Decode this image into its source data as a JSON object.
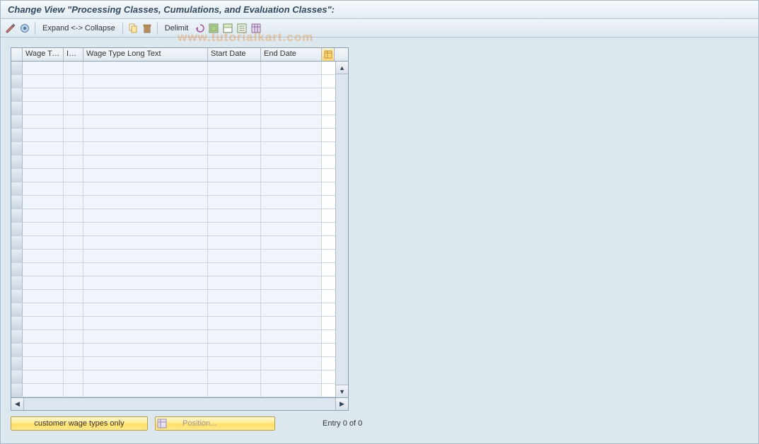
{
  "title": "Change View \"Processing Classes, Cumulations, and Evaluation Classes\":",
  "toolbar": {
    "expand_label": "Expand <-> Collapse",
    "delimit_label": "Delimit"
  },
  "table": {
    "columns": {
      "wage_type": "Wage Ty...",
      "inf": "Inf...",
      "long_text": "Wage Type Long Text",
      "start_date": "Start Date",
      "end_date": "End Date"
    },
    "row_count": 25
  },
  "buttons": {
    "customer": "customer wage types only",
    "position": "Position..."
  },
  "status": {
    "entry": "Entry 0 of 0"
  },
  "watermark": "www.tutorialkart.com"
}
